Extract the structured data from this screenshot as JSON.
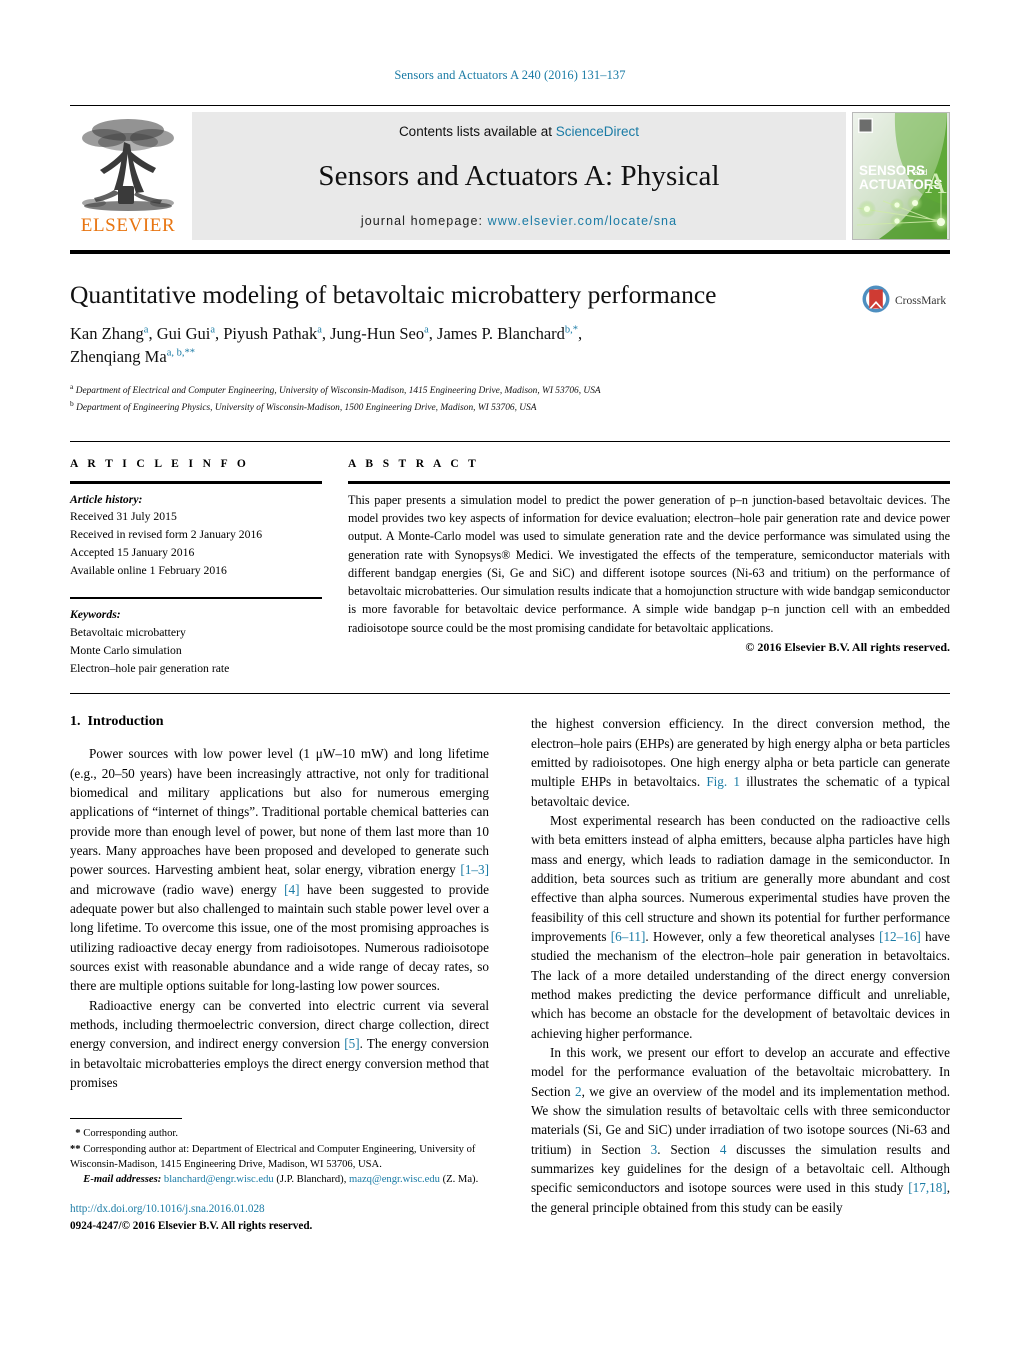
{
  "running_head": "Sensors and Actuators A 240 (2016) 131–137",
  "masthead": {
    "publisher_name": "ELSEVIER",
    "contents_prefix": "Contents lists available at ",
    "contents_link": "ScienceDirect",
    "journal_title": "Sensors and Actuators A: Physical",
    "homepage_prefix": "journal homepage: ",
    "homepage_url": "www.elsevier.com/locate/sna",
    "cover": {
      "line1": "SENSORS",
      "line1_small": "and",
      "line2": "ACTUATORS",
      "letter": "A"
    }
  },
  "article": {
    "title": "Quantitative modeling of betavoltaic microbattery performance",
    "crossmark_label": "CrossMark",
    "authors_line1_parts": [
      {
        "name": "Kan Zhang",
        "sup": "a"
      },
      {
        "name": "Gui Gui",
        "sup": "a"
      },
      {
        "name": "Piyush Pathak",
        "sup": "a"
      },
      {
        "name": "Jung-Hun Seo",
        "sup": "a"
      },
      {
        "name": "James P. Blanchard",
        "sup": "b,*"
      }
    ],
    "authors_line2": [
      {
        "name": "Zhenqiang Ma",
        "sup": "a, b,**"
      }
    ],
    "affiliations": [
      {
        "mark": "a",
        "text": "Department of Electrical and Computer Engineering, University of Wisconsin-Madison, 1415 Engineering Drive, Madison, WI 53706, USA"
      },
      {
        "mark": "b",
        "text": "Department of Engineering Physics, University of Wisconsin-Madison, 1500 Engineering Drive, Madison, WI 53706, USA"
      }
    ]
  },
  "article_info": {
    "heading": "A R T I C L E    I N F O",
    "history_label": "Article history:",
    "history": [
      "Received 31 July 2015",
      "Received in revised form 2 January 2016",
      "Accepted 15 January 2016",
      "Available online 1 February 2016"
    ],
    "keywords_label": "Keywords:",
    "keywords": [
      "Betavoltaic microbattery",
      "Monte Carlo simulation",
      "Electron–hole pair generation rate"
    ]
  },
  "abstract": {
    "heading": "A B S T R A C T",
    "text": "This paper presents a simulation model to predict the power generation of p–n junction-based betavoltaic devices. The model provides two key aspects of information for device evaluation; electron–hole pair generation rate and device power output. A Monte-Carlo model was used to simulate generation rate and the device performance was simulated using the generation rate with Synopsys® Medici. We investigated the effects of the temperature, semiconductor materials with different bandgap energies (Si, Ge and SiC) and different isotope sources (Ni-63 and tritium) on the performance of betavoltaic microbatteries. Our simulation results indicate that a homojunction structure with wide bandgap semiconductor is more favorable for betavoltaic device performance. A simple wide bandgap p–n junction cell with an embedded radioisotope source could be the most promising candidate for betavoltaic applications.",
    "copyright": "© 2016 Elsevier B.V. All rights reserved."
  },
  "body": {
    "section_number": "1.",
    "section_title": "Introduction",
    "left_paragraphs": [
      "Power sources with low power level (1 μW–10 mW) and long lifetime (e.g., 20–50 years) have been increasingly attractive, not only for traditional biomedical and military applications but also for numerous emerging applications of “internet of things”. Traditional portable chemical batteries can provide more than enough level of power, but none of them last more than 10 years. Many approaches have been proposed and developed to generate such power sources. Harvesting ambient heat, solar energy, vibration energy [1–3] and microwave (radio wave) energy [4] have been suggested to provide adequate power but also challenged to maintain such stable power level over a long lifetime. To overcome this issue, one of the most promising approaches is utilizing radioactive decay energy from radioisotopes. Numerous radioisotope sources exist with reasonable abundance and a wide range of decay rates, so there are multiple options suitable for long-lasting low power sources.",
      "Radioactive energy can be converted into electric current via several methods, including thermoelectric conversion, direct charge collection, direct energy conversion, and indirect energy conversion [5]. The energy conversion in betavoltaic microbatteries employs the direct energy conversion method that promises"
    ],
    "right_paragraphs": [
      "the highest conversion efficiency. In the direct conversion method, the electron–hole pairs (EHPs) are generated by high energy alpha or beta particles emitted by radioisotopes. One high energy alpha or beta particle can generate multiple EHPs in betavoltaics. Fig. 1 illustrates the schematic of a typical betavoltaic device.",
      "Most experimental research has been conducted on the radioactive cells with beta emitters instead of alpha emitters, because alpha particles have high mass and energy, which leads to radiation damage in the semiconductor. In addition, beta sources such as tritium are generally more abundant and cost effective than alpha sources. Numerous experimental studies have proven the feasibility of this cell structure and shown its potential for further performance improvements [6–11]. However, only a few theoretical analyses [12–16] have studied the mechanism of the electron–hole pair generation in betavoltaics. The lack of a more detailed understanding of the direct energy conversion method makes predicting the device performance difficult and unreliable, which has become an obstacle for the development of betavoltaic devices in achieving higher performance.",
      "In this work, we present our effort to develop an accurate and effective model for the performance evaluation of the betavoltaic microbattery. In Section 2, we give an overview of the model and its implementation method. We show the simulation results of betavoltaic cells with three semiconductor materials (Si, Ge and SiC) under irradiation of two isotope sources (Ni-63 and tritium) in Section 3. Section 4 discusses the simulation results and summarizes key guidelines for the design of a betavoltaic cell. Although specific semiconductors and isotope sources were used in this study [17,18], the general principle obtained from this study can be easily"
    ]
  },
  "footnotes": {
    "corresponding_1": "Corresponding author.",
    "corresponding_2": "Corresponding author at: Department of Electrical and Computer Engineering, University of Wisconsin-Madison, 1415 Engineering Drive, Madison, WI 53706, USA.",
    "email_label": "E-mail addresses:",
    "email_1": "blanchard@engr.wisc.edu",
    "email_1_owner": "(J.P. Blanchard),",
    "email_2": "mazq@engr.wisc.edu",
    "email_2_owner": "(Z. Ma).",
    "doi": "http://dx.doi.org/10.1016/j.sna.2016.01.028",
    "issn_line": "0924-4247/© 2016 Elsevier B.V. All rights reserved."
  },
  "colors": {
    "link": "#1a7ba5",
    "elsevier_orange": "#e87511",
    "masthead_gray": "#e9e9e9"
  }
}
